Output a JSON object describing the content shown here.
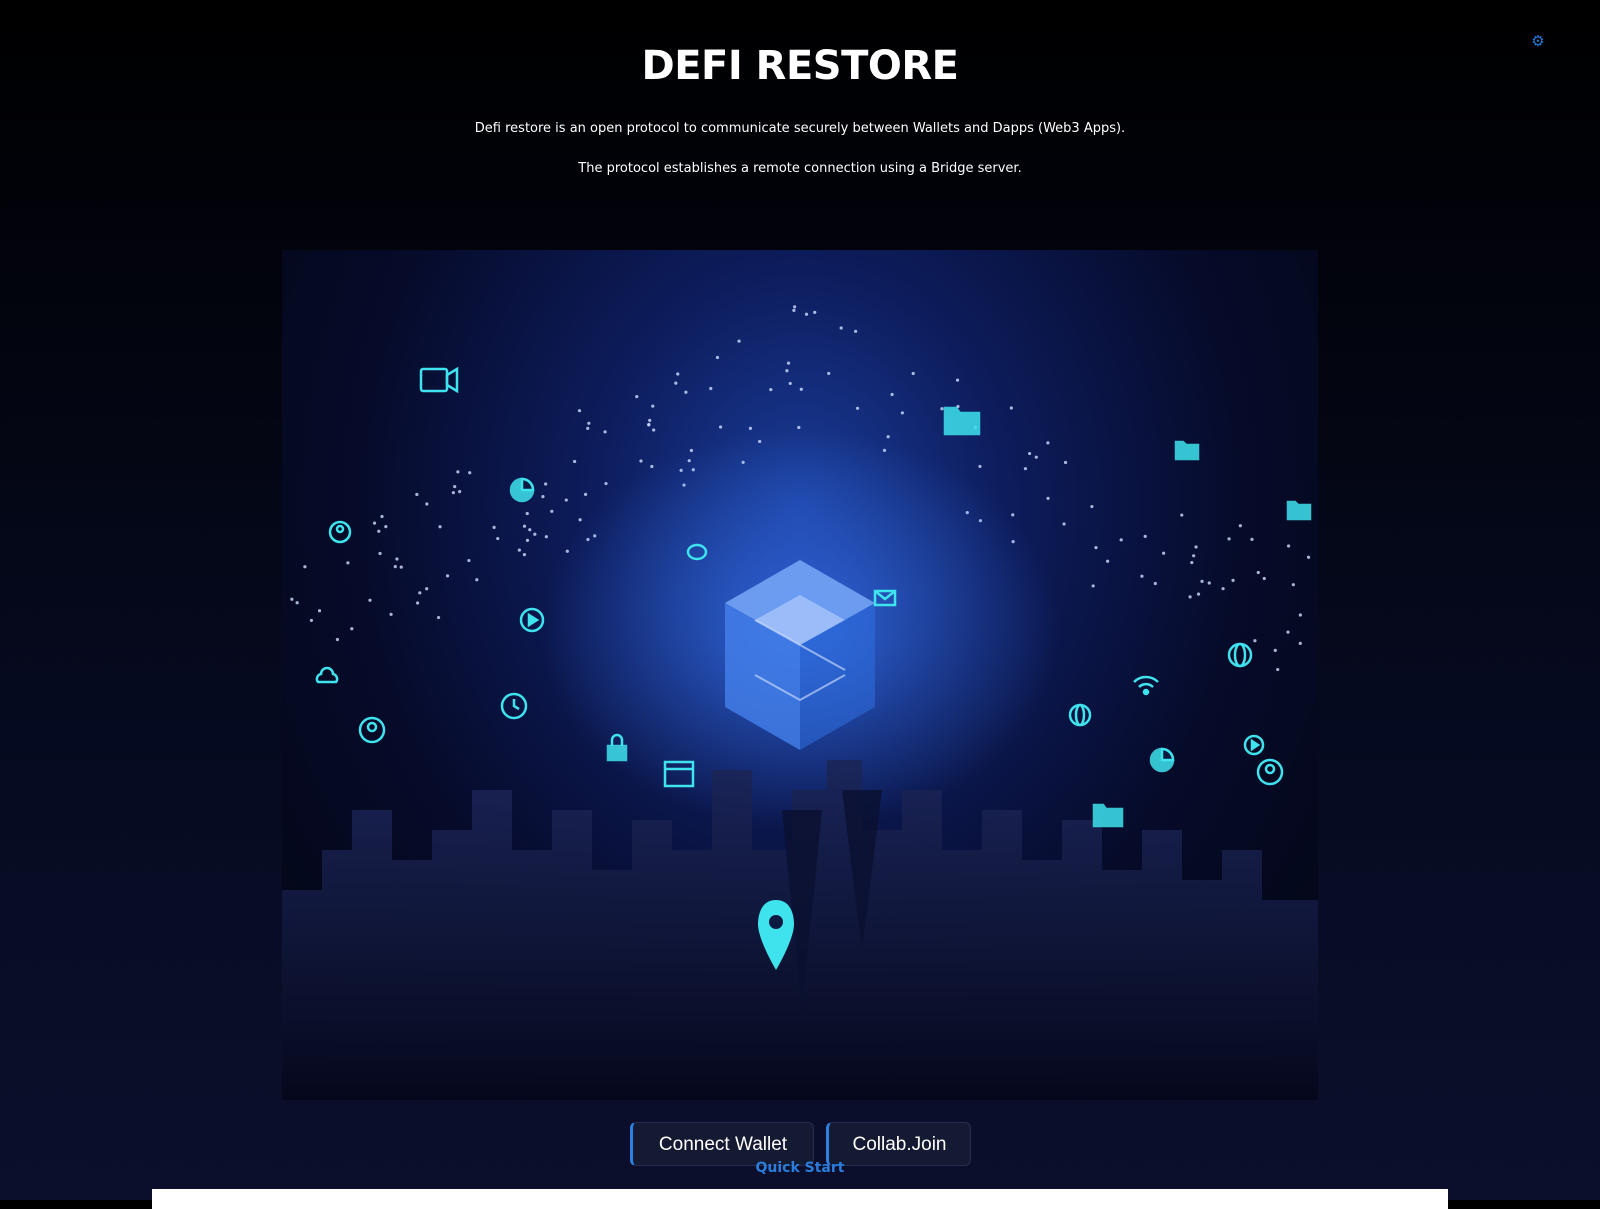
{
  "header": {
    "title": "DEFI RESTORE",
    "description_line1": "Defi restore is an open protocol to communicate securely between Wallets and Dapps (Web3 Apps).",
    "description_line2": "The protocol establishes a remote connection using a Bridge server.",
    "settings_icon": "gear-icon"
  },
  "hero": {
    "icons": [
      "video-camera-icon",
      "folder-icon",
      "pie-chart-icon",
      "user-icon",
      "lock-icon",
      "calendar-icon",
      "location-pin-icon",
      "cube-logo-icon"
    ]
  },
  "actions": {
    "connect_wallet_label": "Connect Wallet",
    "collab_join_label": "Collab.Join"
  },
  "footer": {
    "quick_start_label": "Quick Start"
  },
  "colors": {
    "accent": "#2f7fe0",
    "link": "#2a7ddc",
    "background": "#0b0f2c",
    "icon_cyan": "#3fe3ee"
  }
}
